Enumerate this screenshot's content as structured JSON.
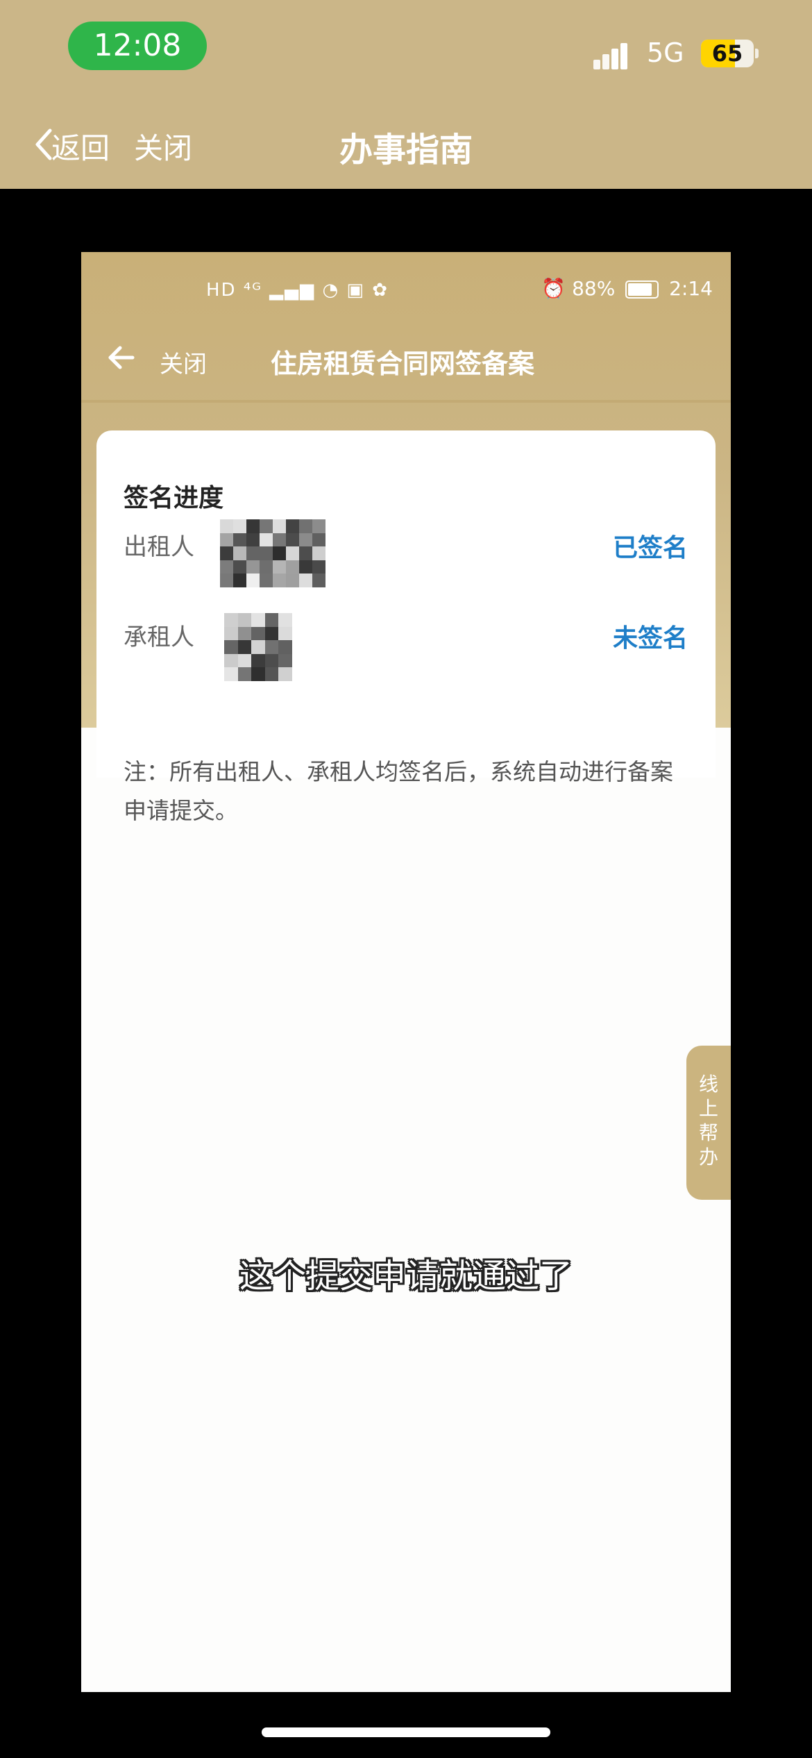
{
  "outer": {
    "time": "12:08",
    "network": "5G",
    "battery": "65",
    "battery_level": 0.65,
    "back_label": "返回",
    "close_label": "关闭",
    "title": "办事指南"
  },
  "inner": {
    "status_left": "HD ⁴ᴳ ▂▄▆ ◔ ▣ ✿",
    "status_battery_pct": "88%",
    "status_time": "2:14",
    "nav": {
      "close_label": "关闭",
      "title": "住房租赁合同网签备案"
    },
    "card": {
      "title": "签名进度",
      "rows": [
        {
          "label": "出租人",
          "status": "已签名"
        },
        {
          "label": "承租人",
          "status": "未签名"
        }
      ]
    },
    "note": "注：所有出租人、承租人均签名后，系统自动进行备案申请提交。",
    "help_tab": [
      "线",
      "上",
      "帮",
      "办"
    ],
    "subtitle": "这个提交申请就通过了",
    "colors": {
      "header_gold": "#cbb688",
      "status_blue": "#1e7ec8",
      "time_green": "#2fb54a"
    }
  }
}
